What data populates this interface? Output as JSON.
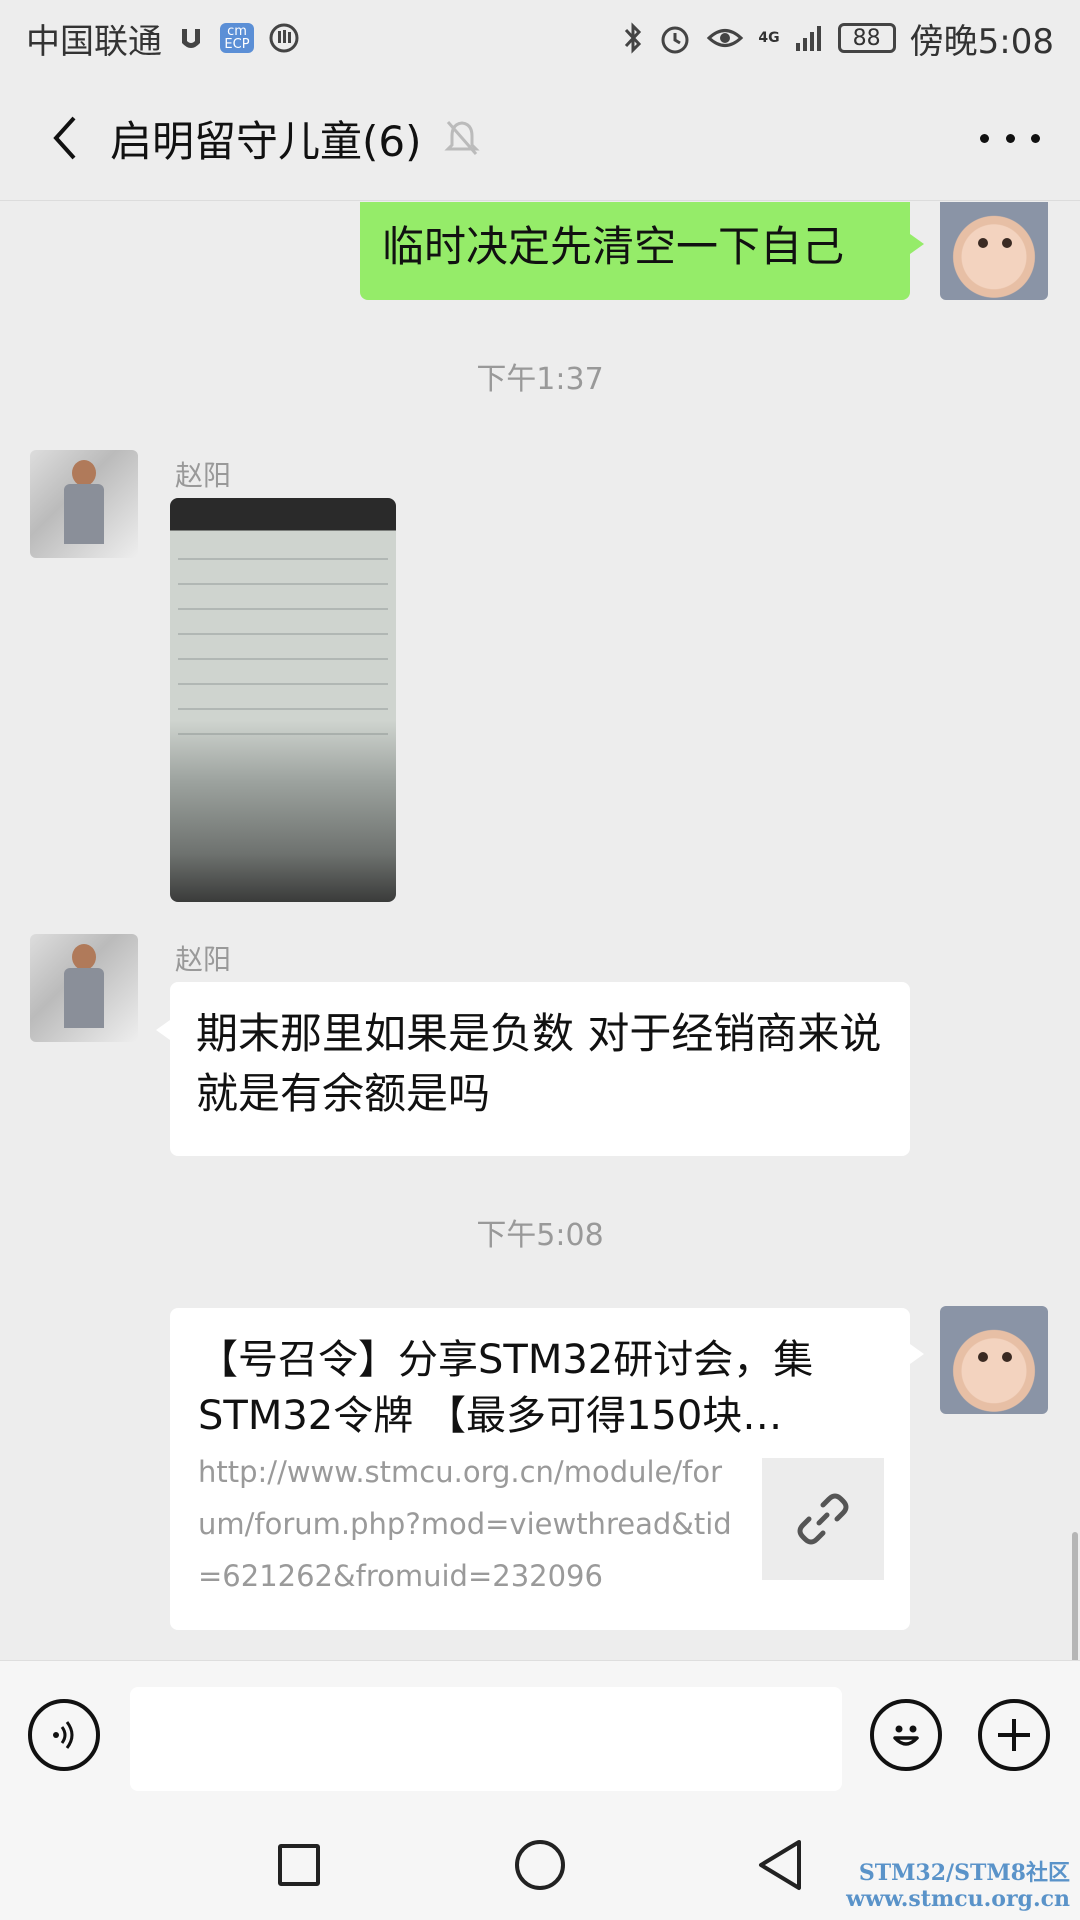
{
  "status_bar": {
    "carrier": "中国联通",
    "badge_text": "cm\nECP",
    "network": "4G",
    "battery": "88",
    "time": "傍晚5:08"
  },
  "header": {
    "title": "启明留守儿童(6)"
  },
  "messages": {
    "m1": {
      "text": "临时决定先清空一下自己"
    },
    "t1": "下午1:37",
    "m2": {
      "sender": "赵阳"
    },
    "m3": {
      "sender": "赵阳",
      "text": "期末那里如果是负数 对于经销商来说就是有余额是吗"
    },
    "t2": "下午5:08",
    "m4": {
      "title": "【号召令】分享STM32研讨会，集STM32令牌 【最多可得150块…",
      "url": "http://www.stmcu.org.cn/module/forum/forum.php?mod=viewthread&tid=621262&fromuid=232096"
    }
  },
  "input": {
    "value": ""
  },
  "watermark": {
    "line1": "STM32/STM8社区",
    "line2": "www.stmcu.org.cn"
  },
  "colors": {
    "bubble_green": "#95ec69",
    "background": "#ededed",
    "watermark": "#5a93c9"
  }
}
